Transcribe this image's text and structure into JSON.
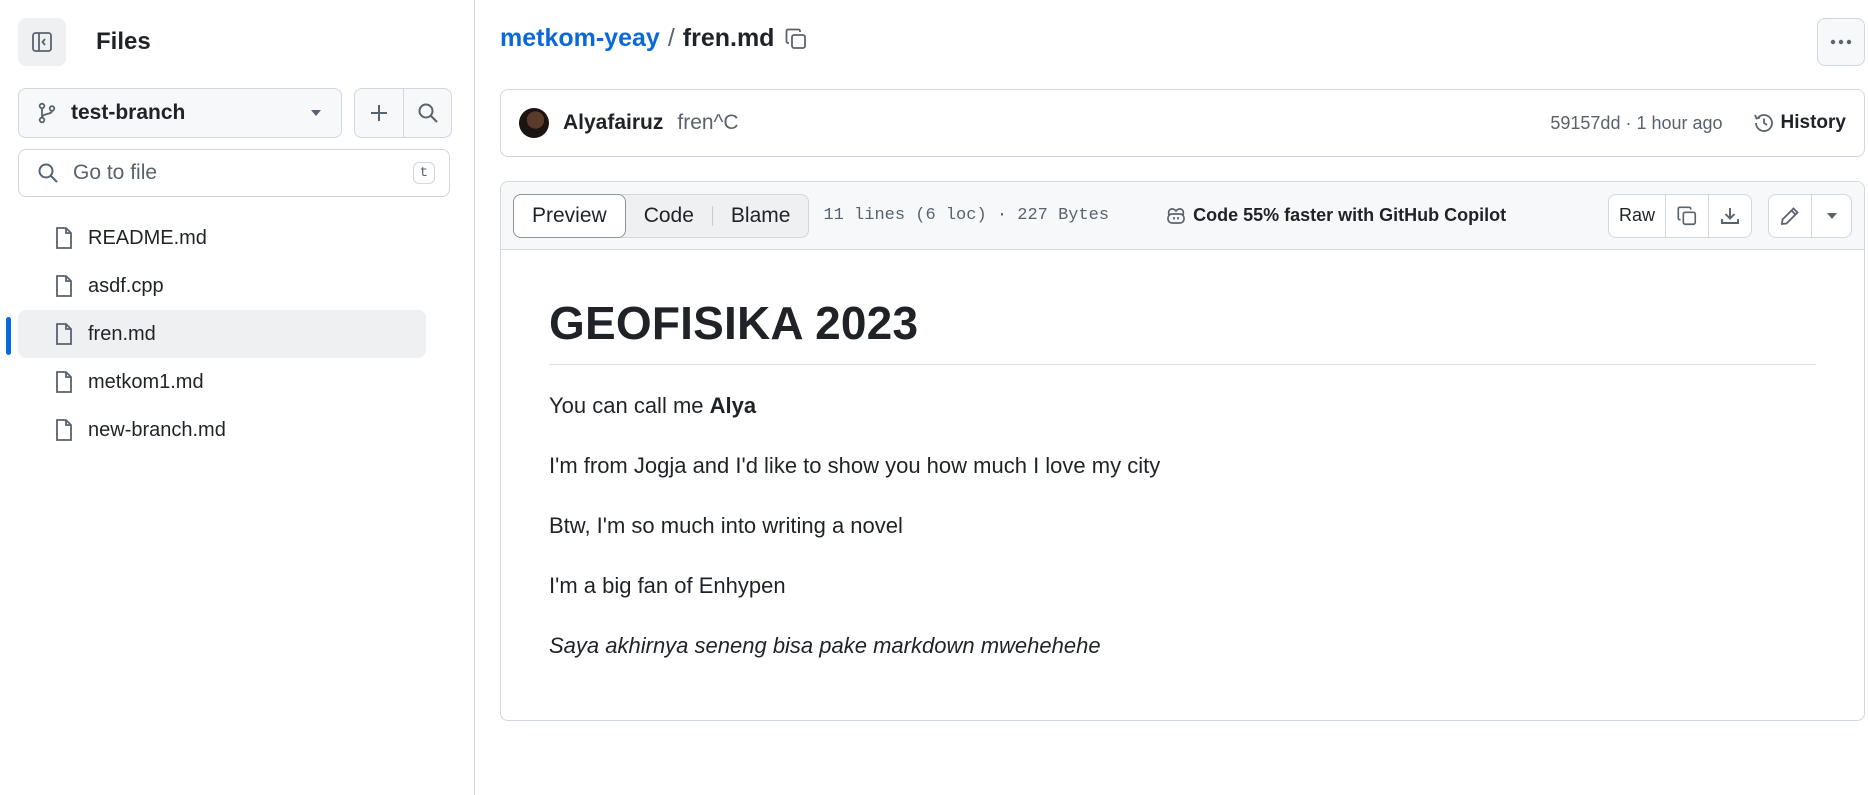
{
  "sidebar": {
    "title": "Files",
    "branch": "test-branch",
    "search_placeholder": "Go to file",
    "search_shortcut": "t",
    "files": [
      {
        "name": "README.md"
      },
      {
        "name": "asdf.cpp"
      },
      {
        "name": "fren.md",
        "active": true
      },
      {
        "name": "metkom1.md"
      },
      {
        "name": "new-branch.md"
      }
    ]
  },
  "header": {
    "repo": "metkom-yeay",
    "separator": "/",
    "file": "fren.md"
  },
  "commit": {
    "author": "Alyafairuz",
    "message": "fren^C",
    "meta": "59157dd · 1 hour ago",
    "history_label": "History"
  },
  "file_view": {
    "tabs": [
      "Preview",
      "Code",
      "Blame"
    ],
    "active_tab": "Preview",
    "info": "11 lines (6 loc) · 227 Bytes",
    "copilot_label": "Code 55% faster with GitHub Copilot",
    "raw_label": "Raw"
  },
  "content": {
    "heading": "GEOFISIKA 2023",
    "line1_prefix": "You can call me ",
    "line1_bold": "Alya",
    "line2": "I'm from Jogja and I'd like to show you how much I love my city",
    "line3": "Btw, I'm so much into writing a novel",
    "line4": "I'm a big fan of Enhypen",
    "line5_italic": "Saya akhirnya seneng bisa pake markdown mwehehehe"
  },
  "colors": {
    "accent": "#0969da",
    "border": "#d0d7de",
    "muted": "#59636e"
  }
}
